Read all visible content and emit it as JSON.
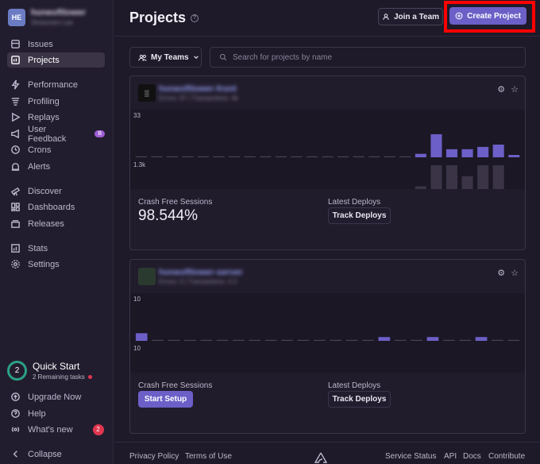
{
  "org": {
    "avatar": "HE",
    "name": "honeoftlower",
    "subtitle": "Sholunsim Lee"
  },
  "sidebar": {
    "items": [
      {
        "label": "Issues",
        "icon": "issues-icon"
      },
      {
        "label": "Projects",
        "icon": "projects-icon"
      },
      {
        "label": "Performance",
        "icon": "lightning-icon"
      },
      {
        "label": "Profiling",
        "icon": "profiling-icon"
      },
      {
        "label": "Replays",
        "icon": "play-icon"
      },
      {
        "label": "User Feedback",
        "icon": "megaphone-icon",
        "badge": "B"
      },
      {
        "label": "Crons",
        "icon": "clock-icon"
      },
      {
        "label": "Alerts",
        "icon": "siren-icon"
      },
      {
        "label": "Discover",
        "icon": "telescope-icon"
      },
      {
        "label": "Dashboards",
        "icon": "dashboard-icon"
      },
      {
        "label": "Releases",
        "icon": "releases-icon"
      },
      {
        "label": "Stats",
        "icon": "stats-icon"
      },
      {
        "label": "Settings",
        "icon": "gear-icon"
      }
    ],
    "quickstart": {
      "count": "2",
      "title": "Quick Start",
      "subtitle": "2 Remaining tasks"
    },
    "bottom": [
      {
        "label": "Upgrade Now",
        "icon": "upgrade-icon"
      },
      {
        "label": "Help",
        "icon": "help-icon"
      },
      {
        "label": "What's new",
        "icon": "broadcast-icon",
        "badge": "2"
      },
      {
        "label": "Collapse",
        "icon": "chevron-left-icon"
      }
    ]
  },
  "header": {
    "title": "Projects",
    "help": "?",
    "join_label": "Join a Team",
    "create_label": "Create Project"
  },
  "filters": {
    "team_label": "My Teams",
    "search_placeholder": "Search for projects by name"
  },
  "projects": [
    {
      "name": "honeoftlower-front",
      "meta": "Errors: 97 | Transactions: 4k",
      "chart_top_label": "33",
      "chart_bottom_label": "1.3k",
      "crash_label": "Crash Free Sessions",
      "crash_value": "98.544%",
      "deploys_label": "Latest Deploys",
      "deploy_button": "Track Deploys"
    },
    {
      "name": "honeoftlower-server",
      "meta": "Errors: 0 | Transactions: 4.3",
      "chart_top_label": "10",
      "chart_bottom_label": "10",
      "crash_label": "Crash Free Sessions",
      "setup_button": "Start Setup",
      "deploys_label": "Latest Deploys",
      "deploy_button": "Track Deploys"
    }
  ],
  "chart_data": [
    {
      "type": "bar",
      "series": [
        {
          "values": [
            0,
            0,
            0,
            0,
            0,
            0,
            0,
            0,
            0,
            0,
            0,
            0,
            0,
            0,
            0,
            0,
            0,
            0,
            3,
            20,
            7,
            7,
            9,
            11,
            1
          ]
        },
        {
          "values": [
            0,
            0,
            0,
            0,
            0,
            0,
            0,
            0,
            0,
            0,
            0,
            0,
            0,
            0,
            0,
            0,
            0,
            0,
            150,
            1300,
            1300,
            700,
            1300,
            1300,
            0
          ]
        }
      ],
      "ylim_top": [
        0,
        33
      ],
      "ylim_bottom": [
        0,
        1300
      ]
    },
    {
      "type": "bar",
      "series": [
        {
          "values": [
            2,
            0,
            0,
            0,
            0,
            0,
            0,
            0,
            0,
            0,
            0,
            0,
            0,
            0,
            0,
            1,
            0,
            0,
            1,
            0,
            0,
            1,
            0,
            0
          ]
        },
        {
          "values": [
            0,
            0,
            0,
            0,
            0,
            0,
            0,
            0,
            0,
            0,
            0,
            0,
            0,
            0,
            0,
            0,
            0,
            0,
            0,
            0,
            0,
            0,
            0,
            0
          ]
        }
      ],
      "ylim_top": [
        0,
        10
      ],
      "ylim_bottom": [
        0,
        10
      ]
    }
  ],
  "footer": {
    "privacy": "Privacy Policy",
    "terms": "Terms of Use",
    "status": "Service Status",
    "api": "API",
    "docs": "Docs",
    "contribute": "Contribute"
  }
}
